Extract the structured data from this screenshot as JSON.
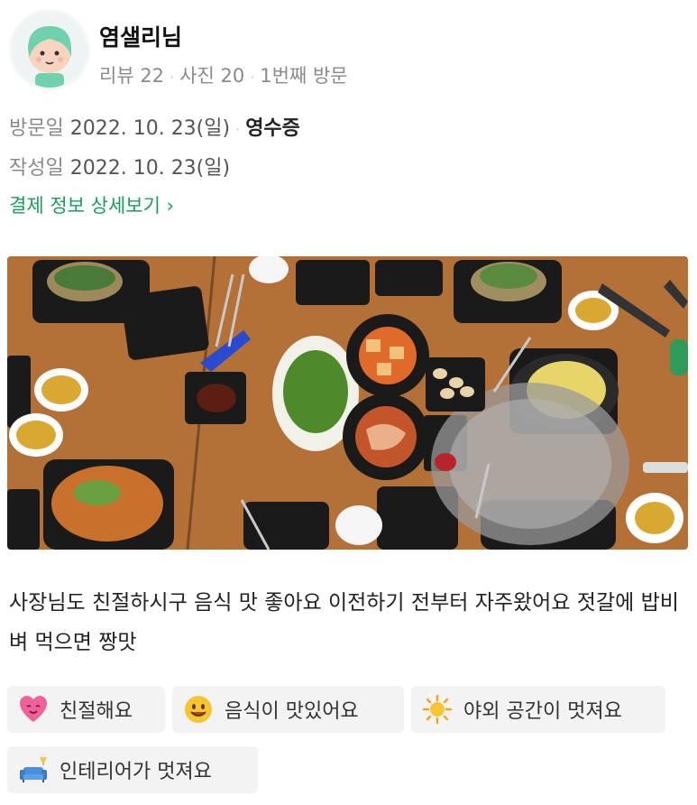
{
  "user": {
    "name": "염샐리님",
    "reviews": "리뷰 22",
    "photos": "사진 20",
    "visit_count": "1번째 방문"
  },
  "visit": {
    "visit_label": "방문일",
    "visit_date": "2022. 10. 23(일)",
    "receipt": "영수증",
    "written_label": "작성일",
    "written_date": "2022. 10. 23(일)"
  },
  "payment_link": "결제 정보 상세보기 ›",
  "review_text": "사장님도 친절하시구 음식 맛 좋아요 이전하기 전부터 자주왔어요 젓갈에 밥비벼 먹으면 짱맛",
  "tags": [
    {
      "icon": "heart-face-icon",
      "label": "친절해요"
    },
    {
      "icon": "smile-icon",
      "label": "음식이 맛있어요"
    },
    {
      "icon": "sun-icon",
      "label": "야외 공간이 멋져요"
    },
    {
      "icon": "sofa-icon",
      "label": "인테리어가 멋져요"
    }
  ],
  "colors": {
    "accent": "#1a9c5c",
    "muted": "#8a8a8a",
    "tag_bg": "#f3f3f3",
    "table_wood": "#b8773c"
  }
}
